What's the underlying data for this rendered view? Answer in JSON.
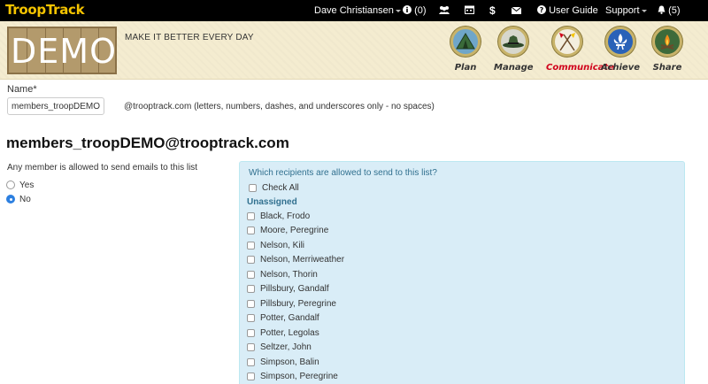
{
  "nav": {
    "brand": "TroopTrack",
    "user": "Dave Christiansen",
    "info_count": "(0)",
    "user_guide": "User Guide",
    "support": "Support",
    "notifications_count": "(5)"
  },
  "banner": {
    "demo": "DEMO",
    "tagline": "MAKE IT BETTER EVERY DAY",
    "badges": [
      {
        "label": "Plan",
        "color": "#333333"
      },
      {
        "label": "Manage",
        "color": "#333333"
      },
      {
        "label": "Communicate",
        "color": "#d0021b"
      },
      {
        "label": "Achieve",
        "color": "#333333"
      },
      {
        "label": "Share",
        "color": "#333333"
      }
    ]
  },
  "form": {
    "name_label": "Name*",
    "name_value": "members_troopDEMO",
    "domain_hint": "@trooptrack.com (letters, numbers, dashes, and underscores only - no spaces)",
    "list_address": "members_troopDEMO@trooptrack.com",
    "allow_label": "Any member is allowed to send emails to this list",
    "options": [
      {
        "label": "Yes",
        "checked": false
      },
      {
        "label": "No",
        "checked": true
      }
    ]
  },
  "recipients": {
    "title": "Which recipients are allowed to send to this list?",
    "check_all": "Check All",
    "group": "Unassigned",
    "members": [
      "Black, Frodo",
      "Moore, Peregrine",
      "Nelson, Kili",
      "Nelson, Merriweather",
      "Nelson, Thorin",
      "Pillsbury, Gandalf",
      "Pillsbury, Peregrine",
      "Potter, Gandalf",
      "Potter, Legolas",
      "Seltzer, John",
      "Simpson, Balin",
      "Simpson, Peregrine"
    ]
  },
  "colors": {
    "accent": "#2c7fe0",
    "panel_bg": "#d9edf7",
    "panel_text": "#31708f",
    "brand_yellow": "#f5c400"
  }
}
